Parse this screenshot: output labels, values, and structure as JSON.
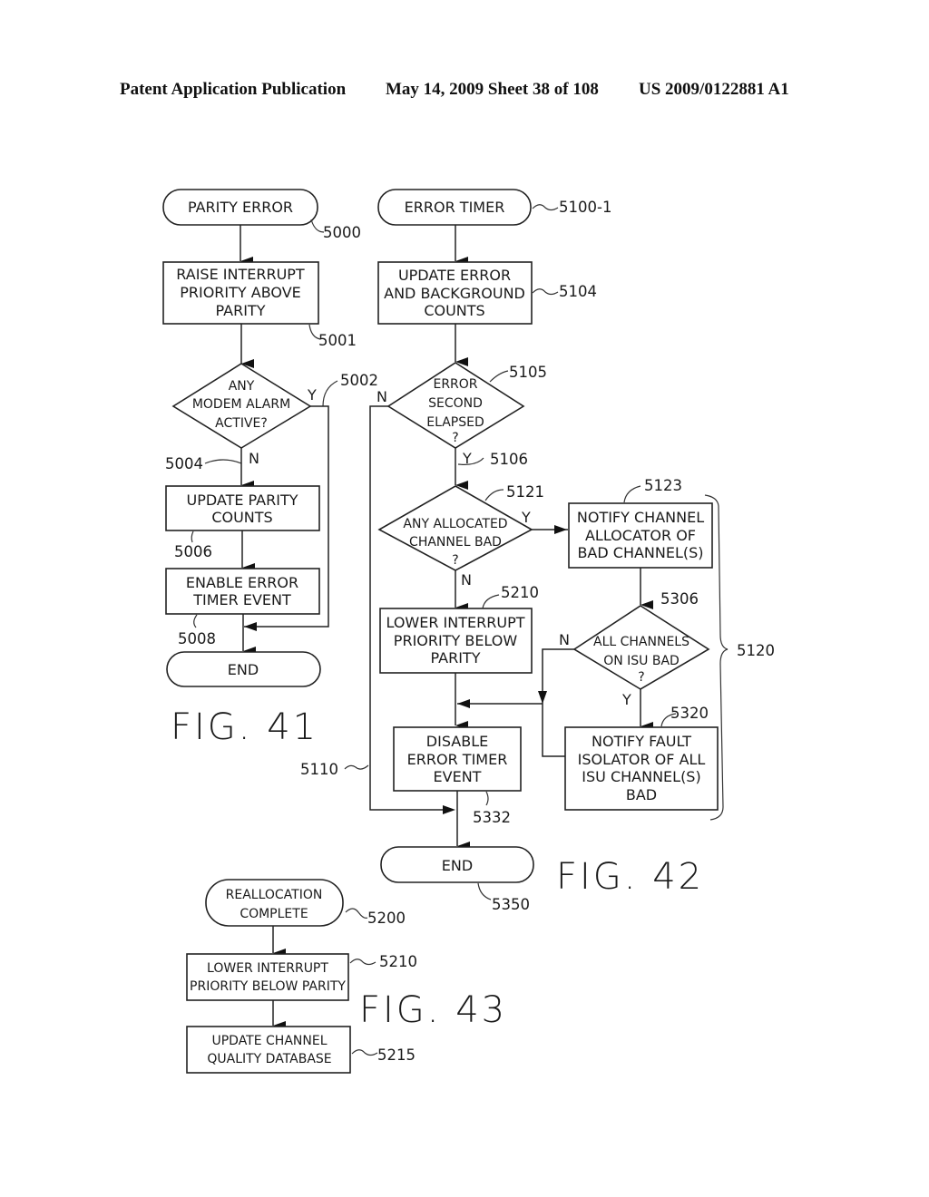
{
  "header": {
    "publication": "Patent Application Publication",
    "date_sheet": "May 14, 2009  Sheet 38 of 108",
    "patent_number": "US 2009/0122881 A1"
  },
  "fig41": {
    "caption": "FIG. 41",
    "start": {
      "lines": [
        "PARITY ERROR"
      ],
      "ref": "5000"
    },
    "raise": {
      "lines": [
        "RAISE INTERRUPT",
        "PRIORITY ABOVE",
        "PARITY"
      ],
      "ref": "5001"
    },
    "decision": {
      "lines": [
        "ANY",
        "MODEM ALARM",
        "ACTIVE?"
      ],
      "ref": "5002",
      "yes": "Y",
      "no": "N"
    },
    "no_ref": "5004",
    "update": {
      "lines": [
        "UPDATE PARITY",
        "COUNTS"
      ],
      "ref": "5006"
    },
    "enable": {
      "lines": [
        "ENABLE ERROR",
        "TIMER EVENT"
      ],
      "ref": "5008"
    },
    "end": {
      "lines": [
        "END"
      ]
    }
  },
  "fig42": {
    "caption": "FIG. 42",
    "start": {
      "lines": [
        "ERROR TIMER"
      ],
      "ref": "5100-1"
    },
    "update": {
      "lines": [
        "UPDATE ERROR",
        "AND BACKGROUND",
        "COUNTS"
      ],
      "ref": "5104"
    },
    "elapsed": {
      "lines": [
        "ERROR",
        "SECOND",
        "ELAPSED",
        "?"
      ],
      "ref": "5105",
      "yes": "Y",
      "no": "N",
      "yes_ref": "5106"
    },
    "allocated": {
      "lines": [
        "ANY ALLOCATED",
        "CHANNEL BAD",
        "?"
      ],
      "ref": "5121",
      "yes": "Y",
      "no": "N"
    },
    "notify_allocator": {
      "lines": [
        "NOTIFY CHANNEL",
        "ALLOCATOR OF",
        "BAD CHANNEL(S)"
      ],
      "ref": "5123"
    },
    "lower": {
      "lines": [
        "LOWER INTERRUPT",
        "PRIORITY BELOW",
        "PARITY"
      ],
      "ref": "5210"
    },
    "all_bad": {
      "lines": [
        "ALL CHANNELS",
        "ON ISU BAD",
        "?"
      ],
      "ref": "5306",
      "yes": "Y",
      "no": "N"
    },
    "notify_fault": {
      "lines": [
        "NOTIFY FAULT",
        "ISOLATOR OF ALL",
        "ISU CHANNEL(S)",
        "BAD"
      ],
      "ref": "5320"
    },
    "disable": {
      "lines": [
        "DISABLE",
        "ERROR TIMER",
        "EVENT"
      ],
      "ref": "5332"
    },
    "bypass_ref": "5110",
    "group_ref": "5120",
    "end": {
      "lines": [
        "END"
      ],
      "ref": "5350"
    }
  },
  "fig43": {
    "caption": "FIG. 43",
    "start": {
      "lines": [
        "REALLOCATION",
        "COMPLETE"
      ],
      "ref": "5200"
    },
    "lower": {
      "lines": [
        "LOWER INTERRUPT",
        "PRIORITY BELOW PARITY"
      ],
      "ref": "5210"
    },
    "update": {
      "lines": [
        "UPDATE CHANNEL",
        "QUALITY DATABASE"
      ],
      "ref": "5215"
    }
  }
}
